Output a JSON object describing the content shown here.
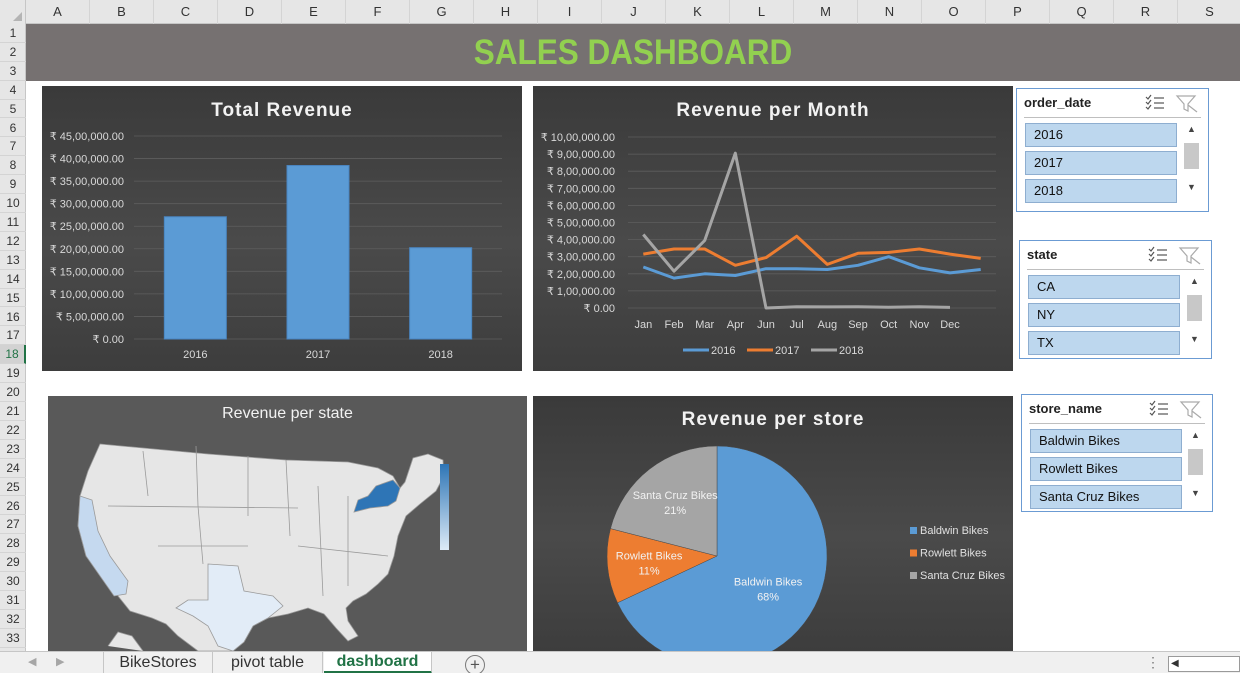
{
  "columns": [
    "A",
    "B",
    "C",
    "D",
    "E",
    "F",
    "G",
    "H",
    "I",
    "J",
    "K",
    "L",
    "M",
    "N",
    "O",
    "P",
    "Q",
    "R",
    "S"
  ],
  "rows": [
    "1",
    "2",
    "3",
    "4",
    "5",
    "6",
    "7",
    "8",
    "9",
    "10",
    "11",
    "12",
    "13",
    "14",
    "15",
    "16",
    "17",
    "18",
    "19",
    "20",
    "21",
    "22",
    "23",
    "24",
    "25",
    "26",
    "27",
    "28",
    "29",
    "30",
    "31",
    "32",
    "33"
  ],
  "active_row": "18",
  "dashboard_title": "SALES DASHBOARD",
  "colors": {
    "accent_green": "#92d050",
    "banner": "#767171",
    "bar": "#5b9bd5",
    "series_2016": "#5b9bd5",
    "series_2017": "#ed7d31",
    "series_2018": "#a5a5a5"
  },
  "total_revenue_chart": {
    "title": "Total Revenue",
    "y_ticks": [
      "₹ 45,00,000.00",
      "₹ 40,00,000.00",
      "₹ 35,00,000.00",
      "₹ 30,00,000.00",
      "₹ 25,00,000.00",
      "₹ 20,00,000.00",
      "₹ 15,00,000.00",
      "₹ 10,00,000.00",
      "₹ 5,00,000.00",
      "₹ 0.00"
    ]
  },
  "monthly_chart": {
    "title": "Revenue per Month",
    "y_ticks": [
      "₹ 10,00,000.00",
      "₹ 9,00,000.00",
      "₹ 8,00,000.00",
      "₹ 7,00,000.00",
      "₹ 6,00,000.00",
      "₹ 5,00,000.00",
      "₹ 4,00,000.00",
      "₹ 3,00,000.00",
      "₹ 2,00,000.00",
      "₹ 1,00,000.00",
      "₹ 0.00"
    ]
  },
  "state_map": {
    "title": "Revenue per state",
    "highlighted_states": [
      "CA",
      "TX",
      "NY"
    ]
  },
  "store_chart": {
    "title": "Revenue per store"
  },
  "chart_data": [
    {
      "type": "bar",
      "title": "Total Revenue",
      "categories": [
        "2016",
        "2017",
        "2018"
      ],
      "values": [
        2709484.47,
        3845515.02,
        2023989.39
      ],
      "ylim": [
        0,
        4500000
      ],
      "grid": true,
      "xlabel": "",
      "ylabel": ""
    },
    {
      "type": "line",
      "title": "Revenue per Month",
      "categories": [
        "Jan",
        "Feb",
        "Mar",
        "Apr",
        "Jun",
        "Jul",
        "Aug",
        "Sep",
        "Oct",
        "Nov",
        "Dec"
      ],
      "series": [
        {
          "name": "2016",
          "values": [
            240000,
            175000,
            200000,
            190000,
            230000,
            230000,
            225000,
            250000,
            300000,
            235000,
            205000,
            225000
          ]
        },
        {
          "name": "2017",
          "values": [
            315000,
            345000,
            345000,
            250000,
            295000,
            420000,
            255000,
            320000,
            325000,
            345000,
            315000,
            290000
          ]
        },
        {
          "name": "2018",
          "values": [
            430000,
            215000,
            395000,
            905000,
            0,
            7000,
            6500,
            7000,
            4500,
            7000,
            3500,
            null
          ]
        }
      ],
      "ylim": [
        0,
        1000000
      ],
      "grid": true,
      "legend": "bottom"
    },
    {
      "type": "pie",
      "title": "Revenue per store",
      "categories": [
        "Baldwin Bikes",
        "Rowlett Bikes",
        "Santa Cruz Bikes"
      ],
      "values": [
        68,
        11,
        21
      ],
      "data_labels": [
        "68%",
        "11%",
        "21%"
      ],
      "legend": "right"
    }
  ],
  "slicers": [
    {
      "title": "order_date",
      "items": [
        "2016",
        "2017",
        "2018"
      ]
    },
    {
      "title": "state",
      "items": [
        "CA",
        "NY",
        "TX"
      ]
    },
    {
      "title": "store_name",
      "items": [
        "Baldwin Bikes",
        "Rowlett Bikes",
        "Santa Cruz Bikes"
      ]
    }
  ],
  "sheet_tabs": [
    "BikeStores",
    "pivot table",
    "dashboard"
  ],
  "active_tab": "dashboard"
}
